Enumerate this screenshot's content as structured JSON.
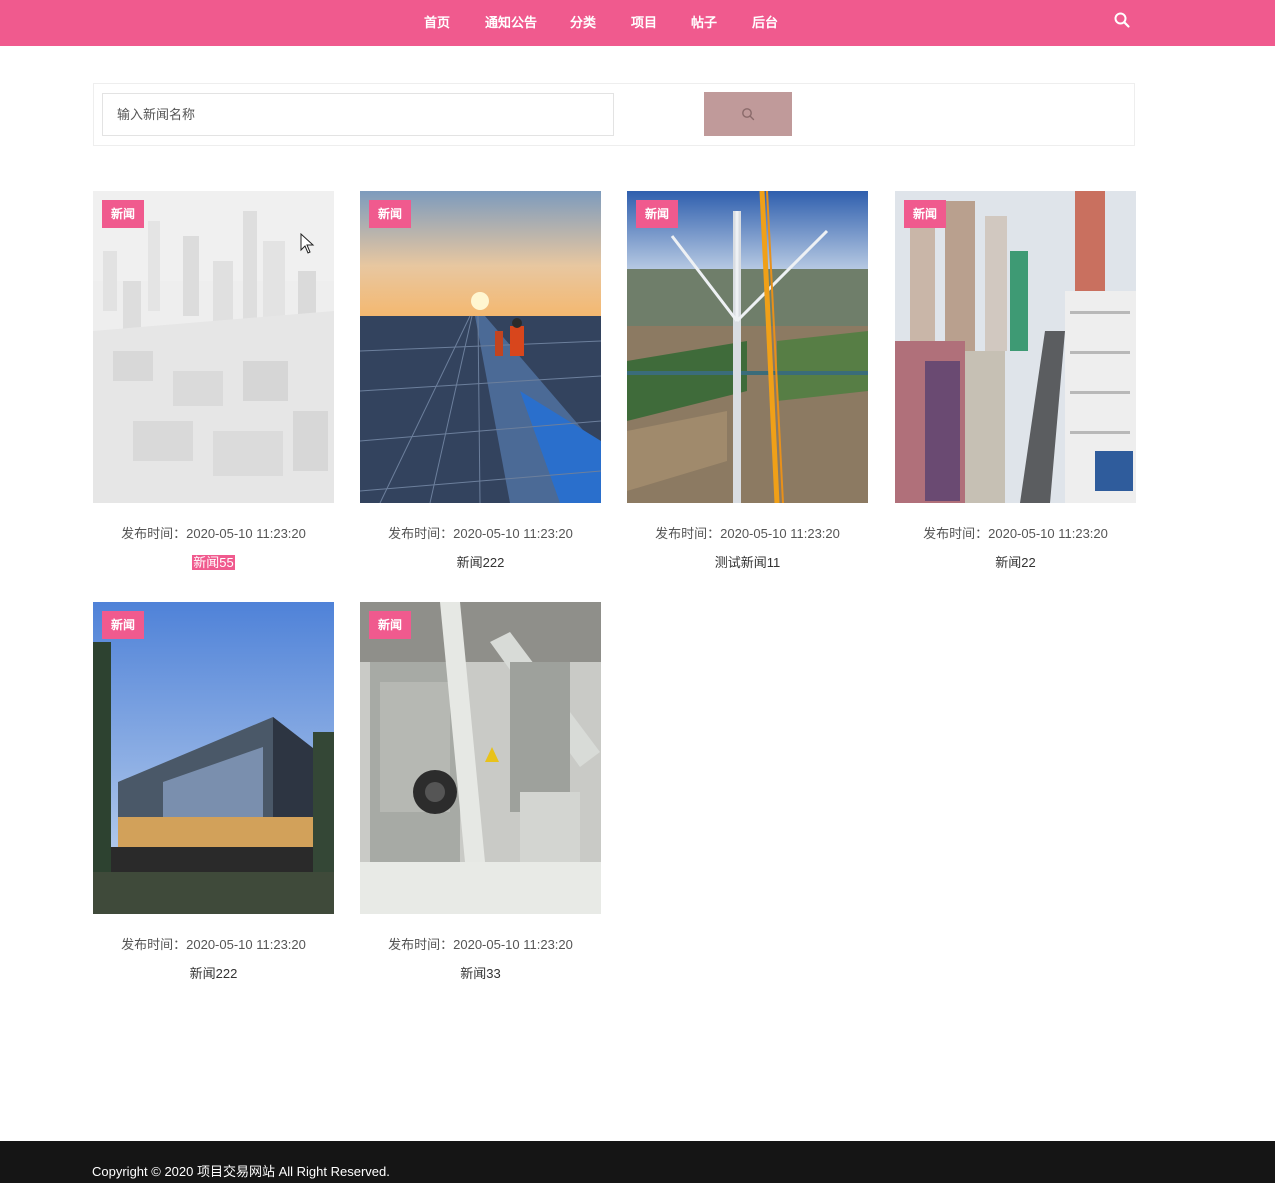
{
  "nav": {
    "items": [
      {
        "label": "首页"
      },
      {
        "label": "通知公告"
      },
      {
        "label": "分类"
      },
      {
        "label": "项目"
      },
      {
        "label": "帖子"
      },
      {
        "label": "后台"
      }
    ],
    "search_icon": "search-icon"
  },
  "search": {
    "placeholder": "输入新闻名称",
    "value": "",
    "button_icon": "search-icon"
  },
  "news": [
    {
      "badge": "新闻",
      "publish_label": "发布时间：",
      "time": "2020-05-10 11:23:20",
      "title": "新闻55",
      "image": "city-skyline-faded"
    },
    {
      "badge": "新闻",
      "publish_label": "发布时间：",
      "time": "2020-05-10 11:23:20",
      "title": "新闻222",
      "image": "solar-panels-sunset"
    },
    {
      "badge": "新闻",
      "publish_label": "发布时间：",
      "time": "2020-05-10 11:23:20",
      "title": "测试新闻11",
      "image": "wind-turbine-fields"
    },
    {
      "badge": "新闻",
      "publish_label": "发布时间：",
      "time": "2020-05-10 11:23:20",
      "title": "新闻22",
      "image": "city-street-buildings"
    },
    {
      "badge": "新闻",
      "publish_label": "发布时间：",
      "time": "2020-05-10 11:23:20",
      "title": "新闻222",
      "image": "modern-building-dusk"
    },
    {
      "badge": "新闻",
      "publish_label": "发布时间：",
      "time": "2020-05-10 11:23:20",
      "title": "新闻33",
      "image": "factory-machinery"
    }
  ],
  "footer": {
    "copyright": "Copyright © 2020 项目交易网站 All Right Reserved."
  },
  "colors": {
    "accent": "#f05a8e",
    "search_button": "#c09a9a",
    "footer_bg": "#151515"
  }
}
